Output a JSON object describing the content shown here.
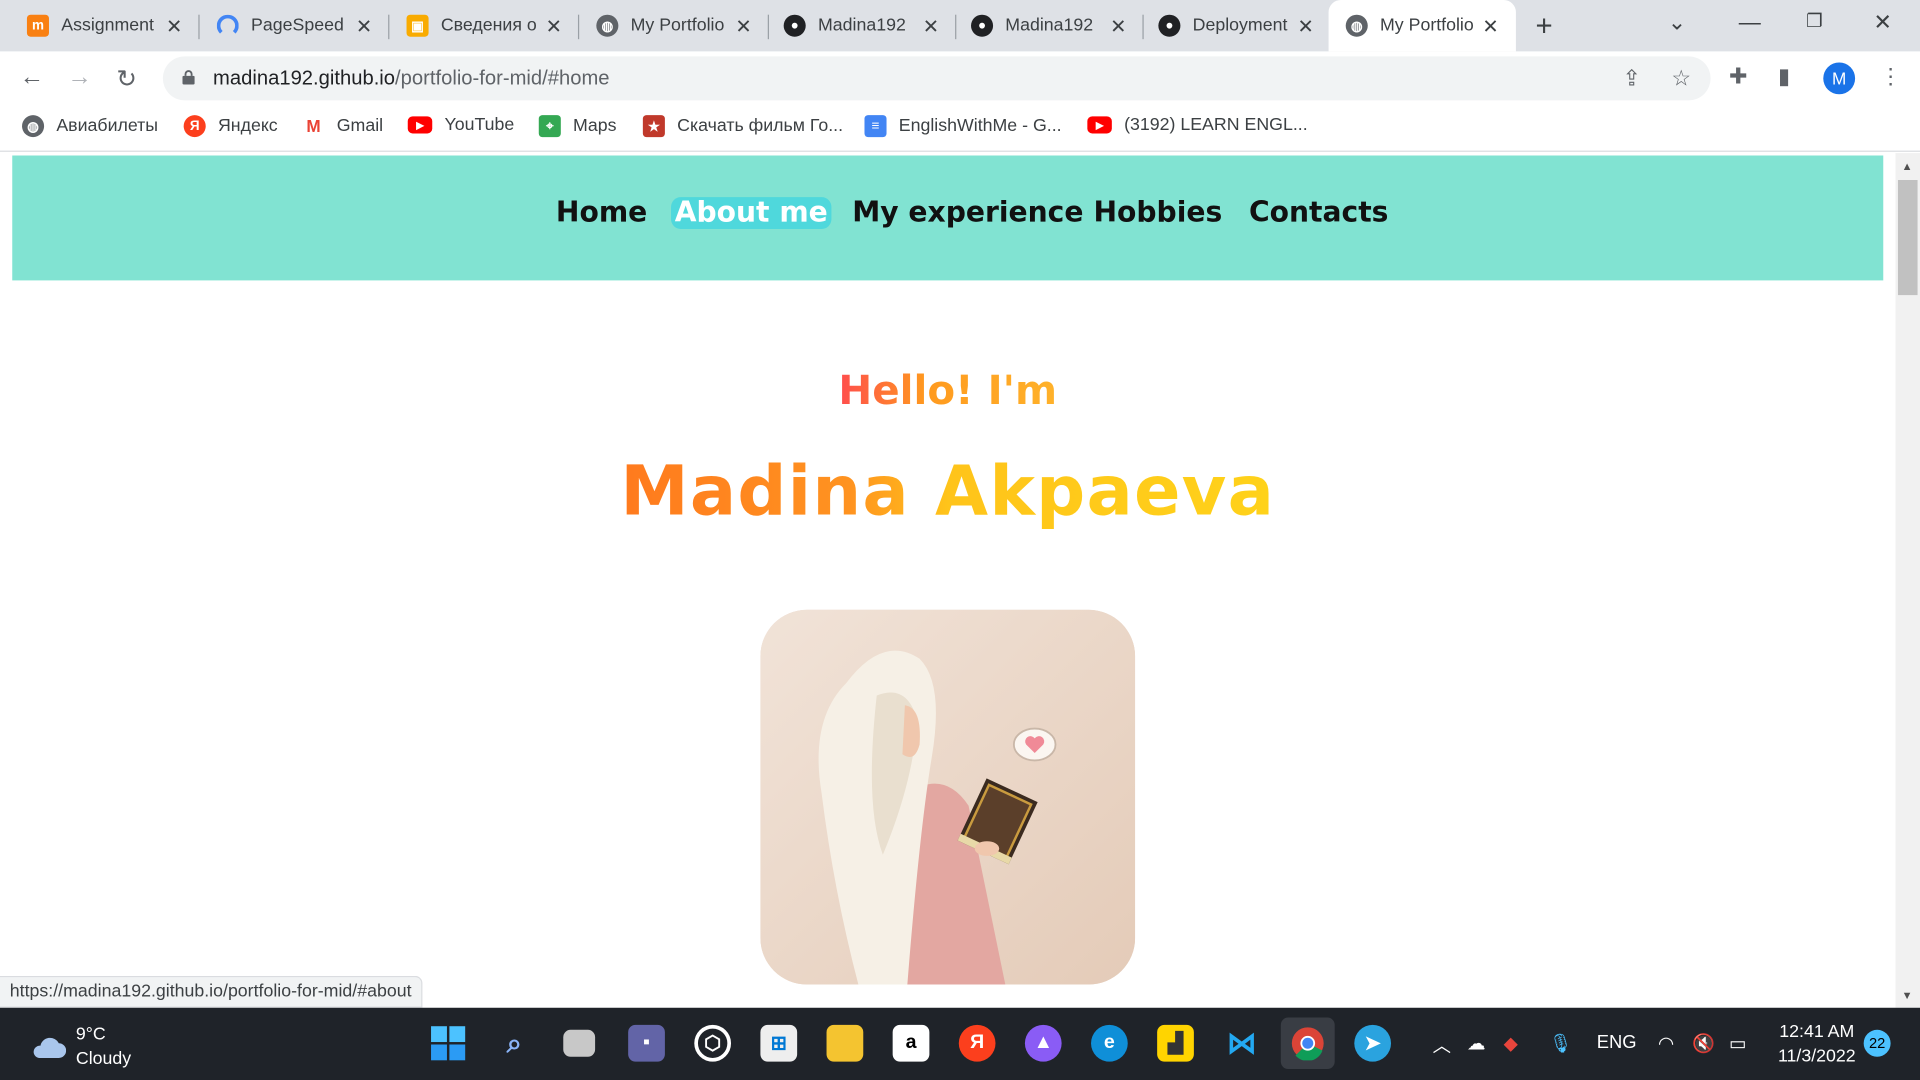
{
  "browser": {
    "tabs": [
      {
        "title": "Assignment",
        "icon": "moodle-icon",
        "color": "#f98012"
      },
      {
        "title": "PageSpeed",
        "icon": "pagespeed-icon",
        "color": "#4285f4"
      },
      {
        "title": "Сведения о",
        "icon": "classroom-icon",
        "color": "#f9ab00"
      },
      {
        "title": "My Portfolio",
        "icon": "globe-icon",
        "color": "#5f6368"
      },
      {
        "title": "Madina192",
        "icon": "github-icon",
        "color": "#202124"
      },
      {
        "title": "Madina192",
        "icon": "github-icon",
        "color": "#202124"
      },
      {
        "title": "Deployment",
        "icon": "github-icon",
        "color": "#202124"
      },
      {
        "title": "My Portfolio",
        "icon": "globe-icon",
        "color": "#5f6368"
      }
    ],
    "url_host": "madina192.github.io",
    "url_path": "/portfolio-for-mid/#home",
    "avatar_letter": "M",
    "bookmarks": [
      {
        "label": "Авиабилеты",
        "icon": "globe-icon"
      },
      {
        "label": "Яндекс",
        "icon": "yandex-icon"
      },
      {
        "label": "Gmail",
        "icon": "gmail-icon"
      },
      {
        "label": "YouTube",
        "icon": "youtube-icon"
      },
      {
        "label": "Maps",
        "icon": "maps-icon"
      },
      {
        "label": "Скачать фильм Го...",
        "icon": "film-icon"
      },
      {
        "label": "EnglishWithMe - G...",
        "icon": "docs-icon"
      },
      {
        "label": "(3192) LEARN ENGL...",
        "icon": "youtube-icon"
      }
    ],
    "status_url": "https://madina192.github.io/portfolio-for-mid/#about"
  },
  "site": {
    "nav": [
      "Home",
      "About me",
      "My experience",
      "Hobbies",
      "Contacts"
    ],
    "active_nav": "About me",
    "greeting": "Hello! I'm",
    "name": "Madina Akpaeva",
    "accent": "#81e3d2"
  },
  "taskbar": {
    "temperature": "9°C",
    "weather": "Cloudy",
    "language": "ENG",
    "time": "12:41 AM",
    "date": "11/3/2022",
    "notifications": "22"
  }
}
